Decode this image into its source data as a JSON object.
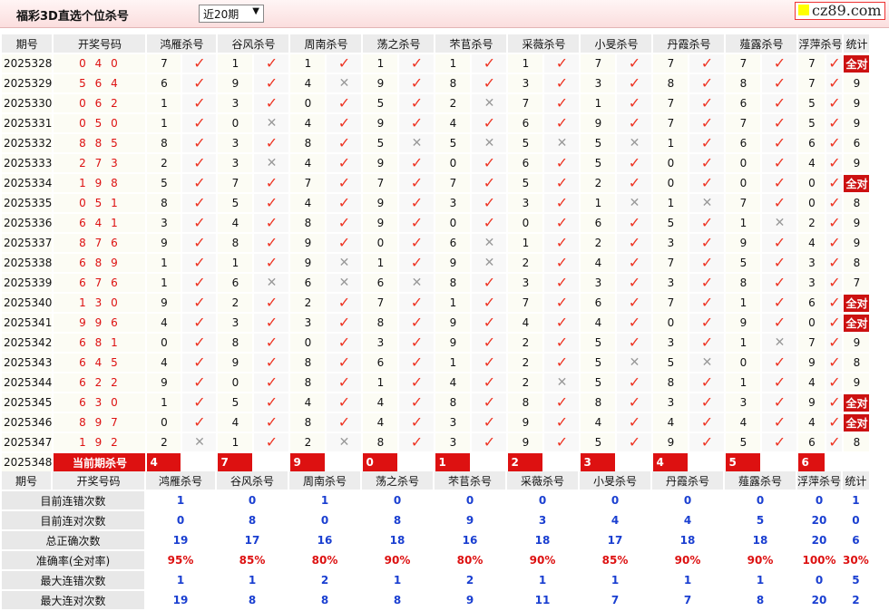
{
  "header": {
    "title": "福彩3D直选个位杀号",
    "period_select": "近20期",
    "logo_text": "cz89.com"
  },
  "columns": {
    "issue": "期号",
    "draw": "开奖号码",
    "stats": "统计",
    "experts": [
      "鸿雁杀号",
      "谷风杀号",
      "周南杀号",
      "荡之杀号",
      "芣苢杀号",
      "采薇杀号",
      "小旻杀号",
      "丹霞杀号",
      "薤露杀号",
      "浮萍杀号"
    ]
  },
  "rows": [
    {
      "issue": "2025328",
      "draw": "0 4 0",
      "kills": [
        "7",
        "1",
        "1",
        "1",
        "1",
        "1",
        "7",
        "7",
        "7",
        "7"
      ],
      "hits": [
        1,
        1,
        1,
        1,
        1,
        1,
        1,
        1,
        1,
        1
      ],
      "stat": "全对"
    },
    {
      "issue": "2025329",
      "draw": "5 6 4",
      "kills": [
        "6",
        "9",
        "4",
        "9",
        "8",
        "3",
        "3",
        "8",
        "8",
        "7"
      ],
      "hits": [
        1,
        1,
        0,
        1,
        1,
        1,
        1,
        1,
        1,
        1
      ],
      "stat": "9"
    },
    {
      "issue": "2025330",
      "draw": "0 6 2",
      "kills": [
        "1",
        "3",
        "0",
        "5",
        "2",
        "7",
        "1",
        "7",
        "6",
        "5"
      ],
      "hits": [
        1,
        1,
        1,
        1,
        0,
        1,
        1,
        1,
        1,
        1
      ],
      "stat": "9"
    },
    {
      "issue": "2025331",
      "draw": "0 5 0",
      "kills": [
        "1",
        "0",
        "4",
        "9",
        "4",
        "6",
        "9",
        "7",
        "7",
        "5"
      ],
      "hits": [
        1,
        0,
        1,
        1,
        1,
        1,
        1,
        1,
        1,
        1
      ],
      "stat": "9"
    },
    {
      "issue": "2025332",
      "draw": "8 8 5",
      "kills": [
        "8",
        "3",
        "8",
        "5",
        "5",
        "5",
        "5",
        "1",
        "6",
        "6"
      ],
      "hits": [
        1,
        1,
        1,
        0,
        0,
        0,
        0,
        1,
        1,
        1
      ],
      "stat": "6"
    },
    {
      "issue": "2025333",
      "draw": "2 7 3",
      "kills": [
        "2",
        "3",
        "4",
        "9",
        "0",
        "6",
        "5",
        "0",
        "0",
        "4"
      ],
      "hits": [
        1,
        0,
        1,
        1,
        1,
        1,
        1,
        1,
        1,
        1
      ],
      "stat": "9"
    },
    {
      "issue": "2025334",
      "draw": "1 9 8",
      "kills": [
        "5",
        "7",
        "7",
        "7",
        "7",
        "5",
        "2",
        "0",
        "0",
        "0"
      ],
      "hits": [
        1,
        1,
        1,
        1,
        1,
        1,
        1,
        1,
        1,
        1
      ],
      "stat": "全对"
    },
    {
      "issue": "2025335",
      "draw": "0 5 1",
      "kills": [
        "8",
        "5",
        "4",
        "9",
        "3",
        "3",
        "1",
        "1",
        "7",
        "0"
      ],
      "hits": [
        1,
        1,
        1,
        1,
        1,
        1,
        0,
        0,
        1,
        1
      ],
      "stat": "8"
    },
    {
      "issue": "2025336",
      "draw": "6 4 1",
      "kills": [
        "3",
        "4",
        "8",
        "9",
        "0",
        "0",
        "6",
        "5",
        "1",
        "2"
      ],
      "hits": [
        1,
        1,
        1,
        1,
        1,
        1,
        1,
        1,
        0,
        1
      ],
      "stat": "9"
    },
    {
      "issue": "2025337",
      "draw": "8 7 6",
      "kills": [
        "9",
        "8",
        "9",
        "0",
        "6",
        "1",
        "2",
        "3",
        "9",
        "4"
      ],
      "hits": [
        1,
        1,
        1,
        1,
        0,
        1,
        1,
        1,
        1,
        1
      ],
      "stat": "9"
    },
    {
      "issue": "2025338",
      "draw": "6 8 9",
      "kills": [
        "1",
        "1",
        "9",
        "1",
        "9",
        "2",
        "4",
        "7",
        "5",
        "3"
      ],
      "hits": [
        1,
        1,
        0,
        1,
        0,
        1,
        1,
        1,
        1,
        1
      ],
      "stat": "8"
    },
    {
      "issue": "2025339",
      "draw": "6 7 6",
      "kills": [
        "1",
        "6",
        "6",
        "6",
        "8",
        "3",
        "3",
        "3",
        "8",
        "3"
      ],
      "hits": [
        1,
        0,
        0,
        0,
        1,
        1,
        1,
        1,
        1,
        1
      ],
      "stat": "7"
    },
    {
      "issue": "2025340",
      "draw": "1 3 0",
      "kills": [
        "9",
        "2",
        "2",
        "7",
        "1",
        "7",
        "6",
        "7",
        "1",
        "6"
      ],
      "hits": [
        1,
        1,
        1,
        1,
        1,
        1,
        1,
        1,
        1,
        1
      ],
      "stat": "全对"
    },
    {
      "issue": "2025341",
      "draw": "9 9 6",
      "kills": [
        "4",
        "3",
        "3",
        "8",
        "9",
        "4",
        "4",
        "0",
        "9",
        "0"
      ],
      "hits": [
        1,
        1,
        1,
        1,
        1,
        1,
        1,
        1,
        1,
        1
      ],
      "stat": "全对"
    },
    {
      "issue": "2025342",
      "draw": "6 8 1",
      "kills": [
        "0",
        "8",
        "0",
        "3",
        "9",
        "2",
        "5",
        "3",
        "1",
        "7"
      ],
      "hits": [
        1,
        1,
        1,
        1,
        1,
        1,
        1,
        1,
        0,
        1
      ],
      "stat": "9"
    },
    {
      "issue": "2025343",
      "draw": "6 4 5",
      "kills": [
        "4",
        "9",
        "8",
        "6",
        "1",
        "2",
        "5",
        "5",
        "0",
        "9"
      ],
      "hits": [
        1,
        1,
        1,
        1,
        1,
        1,
        0,
        0,
        1,
        1
      ],
      "stat": "8"
    },
    {
      "issue": "2025344",
      "draw": "6 2 2",
      "kills": [
        "9",
        "0",
        "8",
        "1",
        "4",
        "2",
        "5",
        "8",
        "1",
        "4"
      ],
      "hits": [
        1,
        1,
        1,
        1,
        1,
        0,
        1,
        1,
        1,
        1
      ],
      "stat": "9"
    },
    {
      "issue": "2025345",
      "draw": "6 3 0",
      "kills": [
        "1",
        "5",
        "4",
        "4",
        "8",
        "8",
        "8",
        "3",
        "3",
        "9"
      ],
      "hits": [
        1,
        1,
        1,
        1,
        1,
        1,
        1,
        1,
        1,
        1
      ],
      "stat": "全对"
    },
    {
      "issue": "2025346",
      "draw": "8 9 7",
      "kills": [
        "0",
        "4",
        "8",
        "4",
        "3",
        "9",
        "4",
        "4",
        "4",
        "4"
      ],
      "hits": [
        1,
        1,
        1,
        1,
        1,
        1,
        1,
        1,
        1,
        1
      ],
      "stat": "全对"
    },
    {
      "issue": "2025347",
      "draw": "1 9 2",
      "kills": [
        "2",
        "1",
        "2",
        "8",
        "3",
        "9",
        "5",
        "9",
        "5",
        "6"
      ],
      "hits": [
        0,
        1,
        0,
        1,
        1,
        1,
        1,
        1,
        1,
        1
      ],
      "stat": "8"
    }
  ],
  "current": {
    "issue": "2025348",
    "label": "当前期杀号",
    "kills": [
      "4",
      "7",
      "9",
      "0",
      "1",
      "2",
      "3",
      "4",
      "5",
      "6"
    ]
  },
  "stats": [
    {
      "label": "目前连错次数",
      "values": [
        "1",
        "0",
        "1",
        "0",
        "0",
        "0",
        "0",
        "0",
        "0",
        "0"
      ],
      "total": "1",
      "color": "blue"
    },
    {
      "label": "目前连对次数",
      "values": [
        "0",
        "8",
        "0",
        "8",
        "9",
        "3",
        "4",
        "4",
        "5",
        "20"
      ],
      "total": "0",
      "color": "blue"
    },
    {
      "label": "总正确次数",
      "values": [
        "19",
        "17",
        "16",
        "18",
        "16",
        "18",
        "17",
        "18",
        "18",
        "20"
      ],
      "total": "6",
      "color": "blue"
    },
    {
      "label": "准确率(全对率)",
      "values": [
        "95%",
        "85%",
        "80%",
        "90%",
        "80%",
        "90%",
        "85%",
        "90%",
        "90%",
        "100%"
      ],
      "total": "30%",
      "color": "red"
    },
    {
      "label": "最大连错次数",
      "values": [
        "1",
        "1",
        "2",
        "1",
        "2",
        "1",
        "1",
        "1",
        "1",
        "0"
      ],
      "total": "5",
      "color": "blue"
    },
    {
      "label": "最大连对次数",
      "values": [
        "19",
        "8",
        "8",
        "8",
        "9",
        "11",
        "7",
        "7",
        "8",
        "20"
      ],
      "total": "2",
      "color": "blue"
    }
  ],
  "icons": {
    "hit": "checkmark-icon",
    "miss": "cross-icon"
  },
  "colors": {
    "accent": "#d11111",
    "blue": "#1a3fd1"
  }
}
